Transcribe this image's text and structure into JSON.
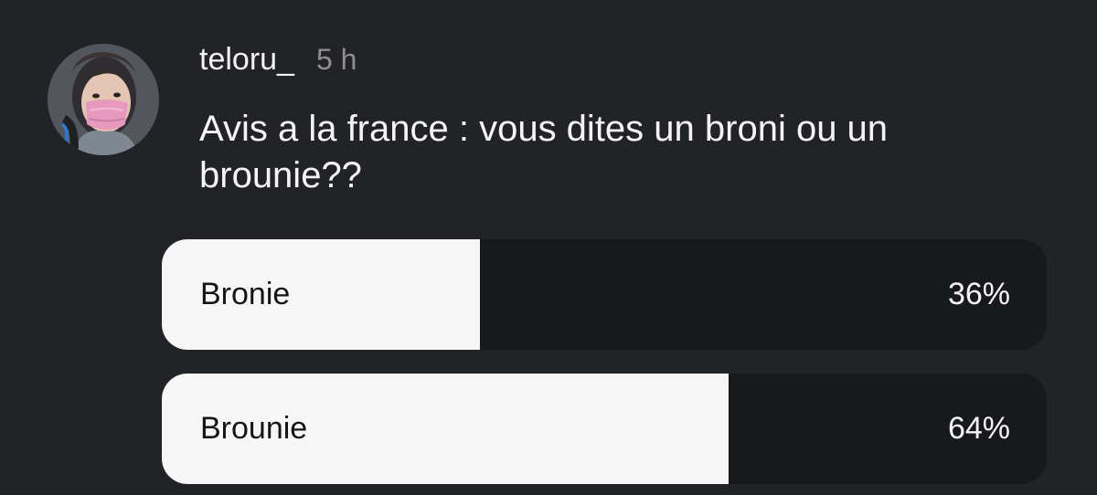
{
  "post": {
    "username": "teloru_",
    "time": "5 h",
    "question": "Avis a la france : vous dites un broni ou un brounie??"
  },
  "poll": {
    "options": [
      {
        "label": "Bronie",
        "percent_text": "36%",
        "percent": 36
      },
      {
        "label": "Brounie",
        "percent_text": "64%",
        "percent": 64
      }
    ]
  },
  "colors": {
    "background": "#222327",
    "poll_fill": "#f6f6f6",
    "poll_track": "#18191c",
    "muted_text": "#8e8e93"
  },
  "icons": {
    "avatar": "profile-photo"
  }
}
